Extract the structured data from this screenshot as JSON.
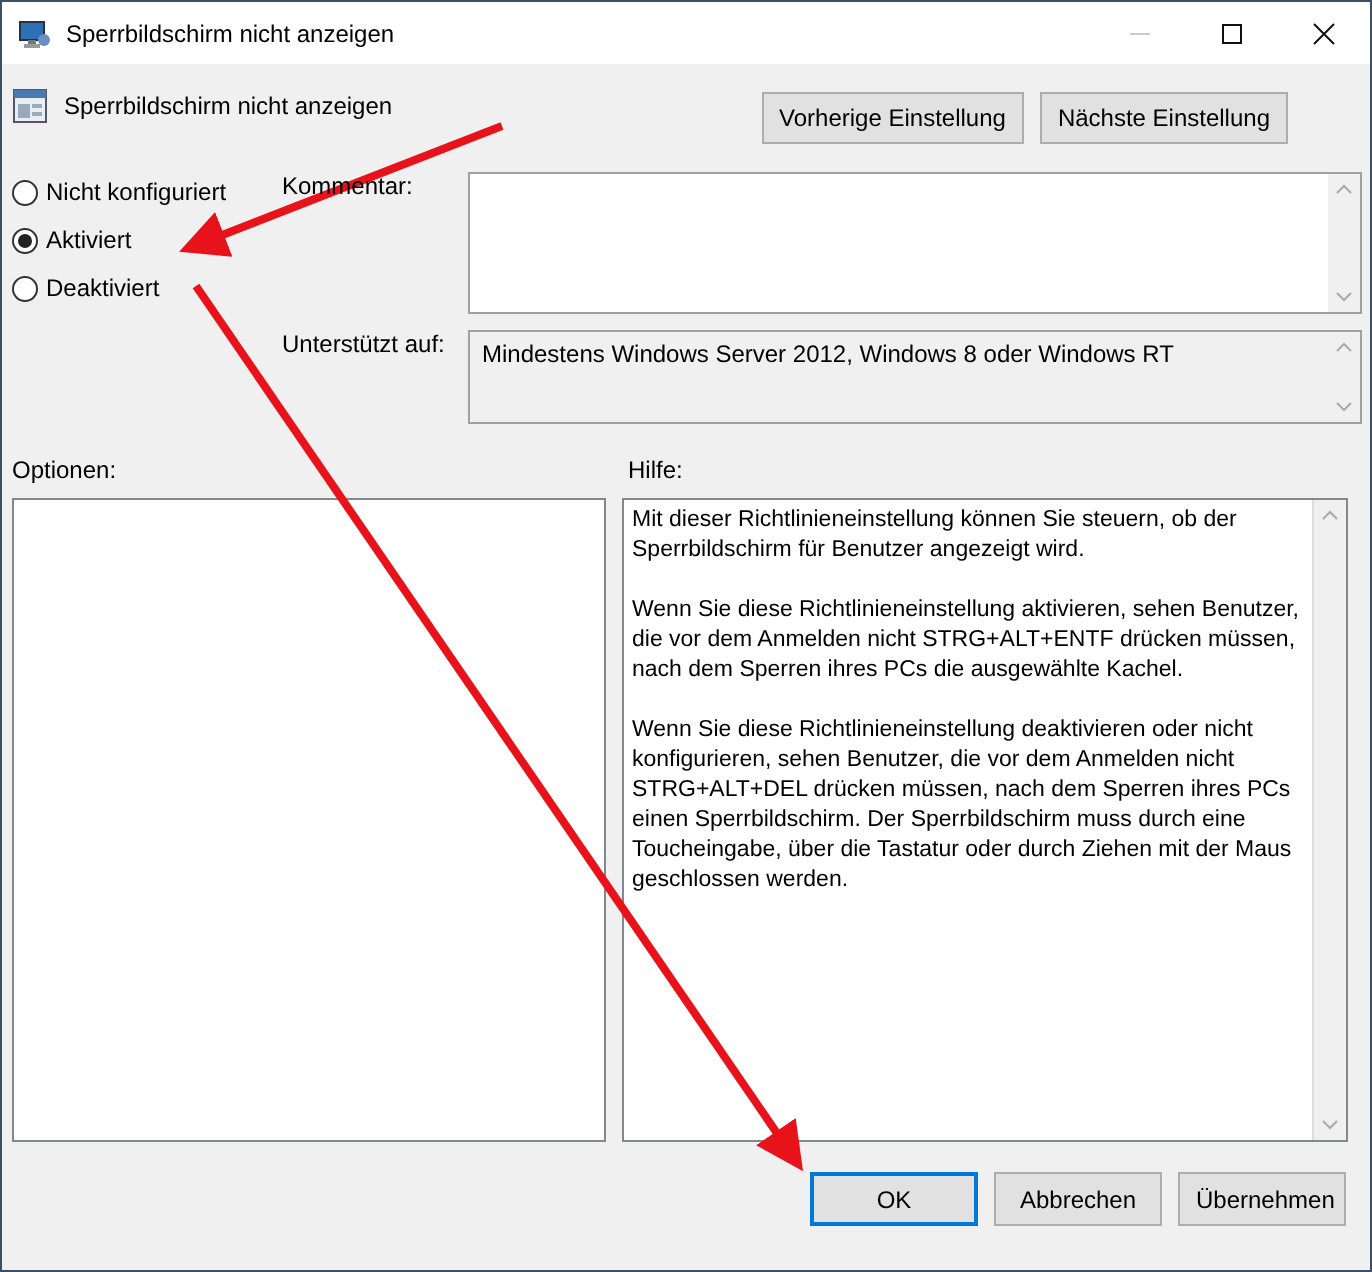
{
  "window": {
    "title": "Sperrbildschirm nicht anzeigen"
  },
  "policy": {
    "name": "Sperrbildschirm nicht anzeigen"
  },
  "navigation_buttons": [
    "Vorherige Einstellung",
    "Nächste Einstellung"
  ],
  "state_options": [
    {
      "label": "Nicht konfiguriert",
      "selected": false
    },
    {
      "label": "Aktiviert",
      "selected": true
    },
    {
      "label": "Deaktiviert",
      "selected": false
    }
  ],
  "comment": {
    "label": "Kommentar:"
  },
  "supported_on": {
    "label": "Unterstützt auf:",
    "value": "Mindestens Windows Server 2012, Windows 8 oder Windows RT"
  },
  "options": {
    "label": "Optionen:"
  },
  "help": {
    "label": "Hilfe:",
    "paragraphs": [
      "Mit dieser Richtlinieneinstellung können Sie steuern, ob der Sperrbildschirm für Benutzer angezeigt wird.",
      "Wenn Sie diese Richtlinieneinstellung aktivieren, sehen Benutzer, die vor dem Anmelden nicht STRG+ALT+ENTF drücken müssen, nach dem Sperren ihres PCs die ausgewählte Kachel.",
      "Wenn Sie diese Richtlinieneinstellung deaktivieren oder nicht konfigurieren, sehen Benutzer, die vor dem Anmelden nicht STRG+ALT+DEL drücken müssen, nach dem Sperren ihres PCs einen Sperrbildschirm. Der Sperrbildschirm muss durch eine Toucheingabe, über die Tastatur oder durch Ziehen mit der Maus geschlossen werden."
    ]
  },
  "buttons": [
    {
      "label": "OK",
      "default": true
    },
    {
      "label": "Abbrechen",
      "default": false
    },
    {
      "label": "Übernehmen",
      "default": false
    }
  ]
}
